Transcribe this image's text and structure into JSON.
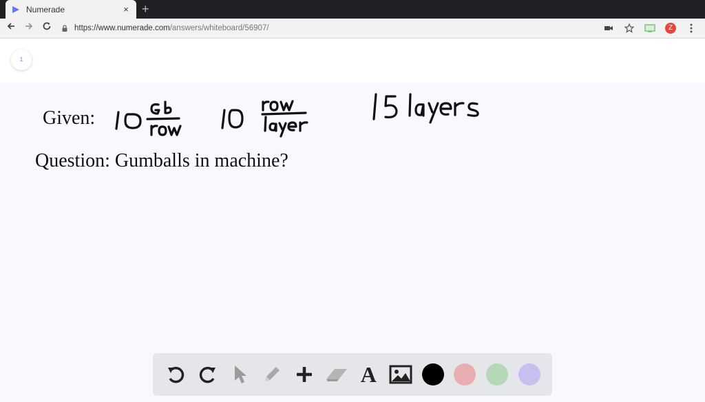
{
  "browser": {
    "tab_title": "Numerade",
    "tab_close": "×",
    "new_tab": "+",
    "url_prefix": "https://www.numerade.com",
    "url_path": "/answers/whiteboard/56907/",
    "profile_initial": "Z"
  },
  "page": {
    "page_number": "1"
  },
  "board": {
    "given_label": "Given:",
    "question_text": "Question: Gumballs in machine?",
    "ink": {
      "given_1_number": "10",
      "given_1_unit_top": "Gb",
      "given_1_unit_bottom": "row",
      "given_2_number": "10",
      "given_2_unit_top": "row",
      "given_2_unit_bottom": "layer",
      "given_3": "15 layers"
    }
  },
  "toolbar": {
    "text_tool_label": "A",
    "colors": {
      "black": "#000000",
      "red": "#e8aeb1",
      "green": "#b5d9b8",
      "purple": "#c6c0f0"
    }
  }
}
